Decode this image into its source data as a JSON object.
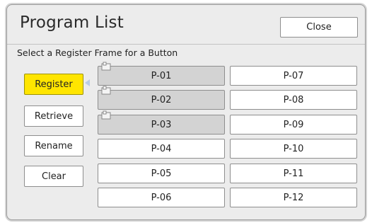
{
  "dialog": {
    "title": "Program List",
    "close_label": "Close",
    "subtitle": "Select a Register Frame for a Button"
  },
  "side_buttons": [
    {
      "label": "Register",
      "active": true
    },
    {
      "label": "Retrieve",
      "active": false
    },
    {
      "label": "Rename",
      "active": false
    },
    {
      "label": "Clear",
      "active": false
    }
  ],
  "programs": [
    {
      "label": "P-01",
      "registered": true,
      "icon": "program-tag-icon"
    },
    {
      "label": "P-02",
      "registered": true,
      "icon": "program-tag-icon"
    },
    {
      "label": "P-03",
      "registered": true,
      "icon": "program-tag-icon"
    },
    {
      "label": "P-04",
      "registered": false
    },
    {
      "label": "P-05",
      "registered": false
    },
    {
      "label": "P-06",
      "registered": false
    },
    {
      "label": "P-07",
      "registered": false
    },
    {
      "label": "P-08",
      "registered": false
    },
    {
      "label": "P-09",
      "registered": false
    },
    {
      "label": "P-10",
      "registered": false
    },
    {
      "label": "P-11",
      "registered": false
    },
    {
      "label": "P-12",
      "registered": false
    }
  ],
  "colors": {
    "active_button": "#ffe500",
    "registered_slot": "#d3d3d3",
    "panel_background": "#ececec"
  }
}
